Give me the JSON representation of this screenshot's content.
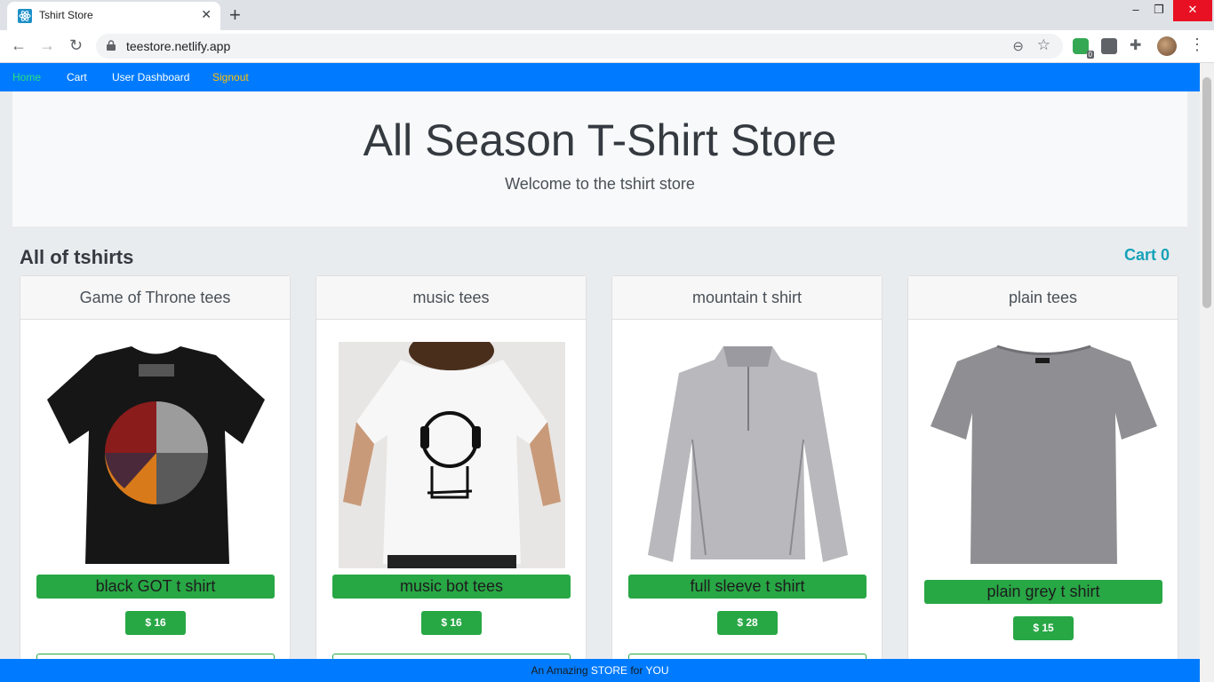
{
  "browser": {
    "tab_title": "Tshirt Store",
    "tab_close": "✕",
    "new_tab": "+",
    "url": "teestore.netlify.app",
    "extension_badge": "0",
    "window_controls": {
      "minimize": "–",
      "maximize": "❐",
      "close": "✕"
    },
    "icons": {
      "back": "←",
      "forward": "→",
      "reload": "↻",
      "zoom": "⊖",
      "star": "☆",
      "puzzle": "✚",
      "menu": "⋮"
    }
  },
  "navbar": {
    "links": [
      {
        "label": "Home",
        "active": true
      },
      {
        "label": "Cart"
      },
      {
        "label": "User Dashboard"
      },
      {
        "label": "Signout"
      }
    ],
    "colors": {
      "background": "#007bff",
      "active": "#28e17b",
      "signout": "#ffc107"
    }
  },
  "jumbotron": {
    "title": "All Season T-Shirt Store",
    "subtitle": "Welcome to the tshirt store"
  },
  "section": {
    "title": "All of tshirts",
    "cart_label": "Cart 0"
  },
  "products": [
    {
      "category": "Game of Throne tees",
      "name": "black GOT t shirt",
      "price": "$ 16"
    },
    {
      "category": "music tees",
      "name": "music bot tees",
      "price": "$ 16"
    },
    {
      "category": "mountain t shirt",
      "name": "full sleeve t shirt",
      "price": "$ 28"
    },
    {
      "category": "plain tees",
      "name": "plain grey t shirt",
      "price": "$ 15"
    }
  ],
  "footer": {
    "prefix": "An Amazing",
    "store": "STORE",
    "middle": "for",
    "you": "YOU"
  },
  "colors": {
    "accent": "#007bff",
    "success": "#28a745",
    "info": "#17a2b8",
    "jumbotron": "#f8f9fa"
  }
}
